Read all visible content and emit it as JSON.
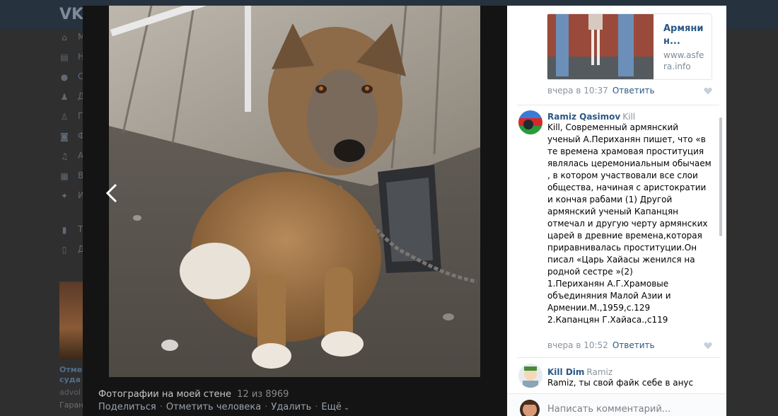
{
  "background_page": {
    "logo": "VK",
    "nav_initials": [
      "М",
      "Н",
      "С",
      "Д",
      "Г",
      "Ф",
      "А",
      "В",
      "И",
      "Т",
      "Д"
    ],
    "ad_lines": [
      "Отме",
      "суда",
      "advol",
      "Гаран"
    ]
  },
  "viewer": {
    "album_title": "Фотографии на моей стене",
    "counter": "12 из 8969",
    "actions": {
      "share": "Поделиться",
      "tag_person": "Отметить человека",
      "delete": "Удалить",
      "more": "Ещё"
    }
  },
  "comments": {
    "link_card": {
      "title": "Армянин...",
      "domain": "www.asfera.info"
    },
    "first_meta": {
      "time": "вчера в 10:37",
      "reply": "Ответить"
    },
    "items": [
      {
        "author": "Ramiz Qasimov",
        "addressee": "Kill",
        "lines": [
          "Kill, Современный армянский ученый А.Периханян пишет, что «в те времена храмовая проституция являлась церемониальным обычаем , в котором участвовали все слои общества, начиная с аристократии и кончая рабами (1) Другой армянский ученый Капанцян отмечал и другую черту армянских царей в древние времена,которая приравнивалась проституции.Он писал «Царь Хайасы женился на родной сестре »(2)",
          "1.Периханян А.Г.Храмовые объединяния Малой Азии и Армении.М.,1959,с.129",
          "2.Капанцян Г.Хайаса.,с119"
        ],
        "time": "вчера в 10:52",
        "reply": "Ответить"
      },
      {
        "author": "Kill Dim",
        "addressee": "Ramiz",
        "lines": [
          "Ramiz, ты свой файк себе в анус"
        ]
      }
    ],
    "input": {
      "placeholder": "Написать комментарий..."
    }
  }
}
